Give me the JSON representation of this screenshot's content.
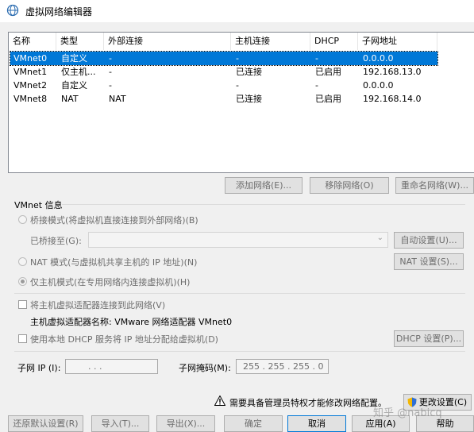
{
  "window": {
    "title": "虚拟网络编辑器"
  },
  "table": {
    "columns": [
      "名称",
      "类型",
      "外部连接",
      "主机连接",
      "DHCP",
      "子网地址"
    ],
    "rows": [
      {
        "name": "VMnet0",
        "type": "自定义",
        "external": "-",
        "host": "-",
        "dhcp": "-",
        "subnet": "0.0.0.0"
      },
      {
        "name": "VMnet1",
        "type": "仅主机...",
        "external": "-",
        "host": "已连接",
        "dhcp": "已启用",
        "subnet": "192.168.13.0"
      },
      {
        "name": "VMnet2",
        "type": "自定义",
        "external": "-",
        "host": "-",
        "dhcp": "-",
        "subnet": "0.0.0.0"
      },
      {
        "name": "VMnet8",
        "type": "NAT",
        "external": "NAT",
        "host": "已连接",
        "dhcp": "已启用",
        "subnet": "192.168.14.0"
      }
    ]
  },
  "list_buttons": {
    "add": "添加网络(E)...",
    "remove": "移除网络(O)",
    "rename": "重命名网络(W)..."
  },
  "vmnet_info": {
    "title": "VMnet 信息",
    "bridge_label": "桥接模式(将虚拟机直接连接到外部网络)(B)",
    "bridge_to_label": "已桥接至(G):",
    "auto_button": "自动设置(U)...",
    "nat_label": "NAT 模式(与虚拟机共享主机的 IP 地址)(N)",
    "nat_button": "NAT 设置(S)...",
    "host_only_label": "仅主机模式(在专用网络内连接虚拟机)(H)",
    "connect_adapter_label": "将主机虚拟适配器连接到此网络(V)",
    "adapter_name_label": "主机虚拟适配器名称: VMware 网络适配器 VMnet0",
    "dhcp_label": "使用本地 DHCP 服务将 IP 地址分配给虚拟机(D)",
    "dhcp_button": "DHCP 设置(P)...",
    "subnet_ip_label": "子网 IP (I):",
    "subnet_ip_value": ".       .       .",
    "mask_label": "子网掩码(M):",
    "mask_value": "255 . 255 . 255 .  0"
  },
  "admin": {
    "warning": "需要具备管理员特权才能修改网络配置。",
    "change_button": "更改设置(C)"
  },
  "footer": {
    "restore": "还原默认设置(R)",
    "import": "导入(T)...",
    "export": "导出(X)...",
    "ok": "确定",
    "cancel": "取消",
    "apply": "应用(A)",
    "help": "帮助"
  },
  "watermark": "知乎 @nabicq",
  "colors": {
    "selection": "#0078d7",
    "accent_border": "#0078d7"
  }
}
